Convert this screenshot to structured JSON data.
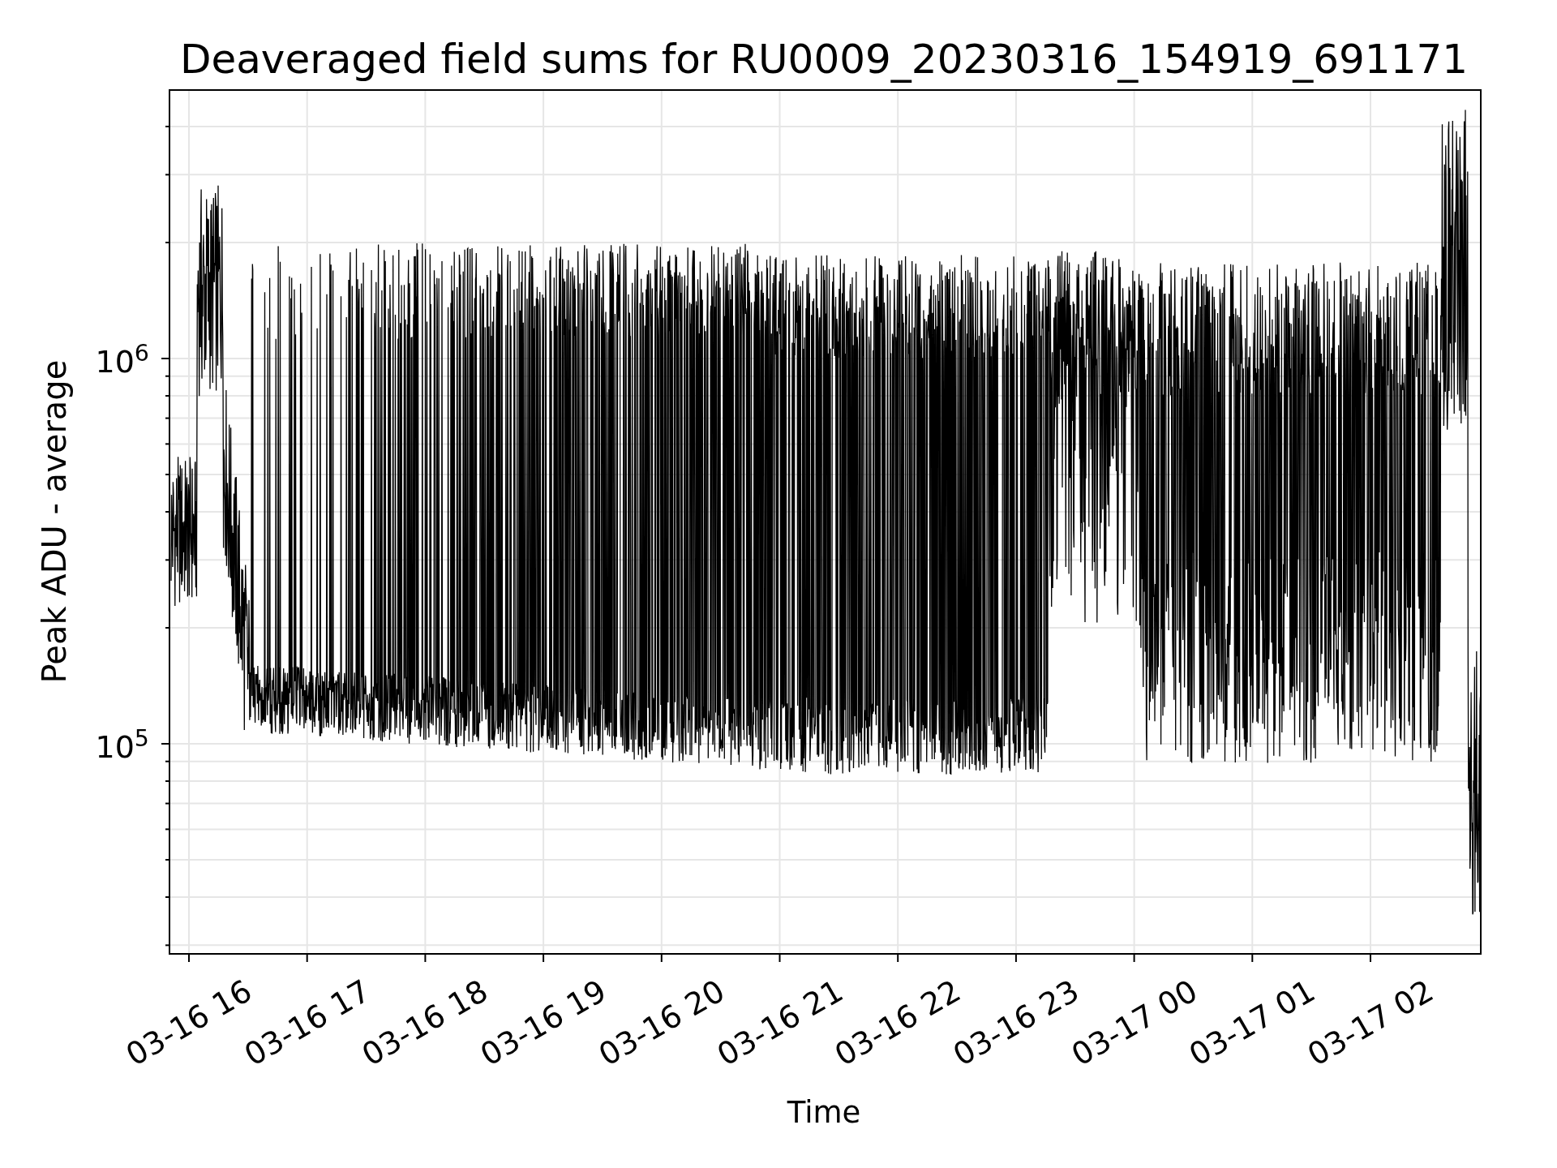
{
  "chart": {
    "title": "Deaveraged field sums for RU0009_20230316_154919_691171",
    "xlabel": "Time",
    "ylabel": "Peak ADU - average",
    "xtick_labels": [
      "03-16 16",
      "03-16 17",
      "03-16 18",
      "03-16 19",
      "03-16 20",
      "03-16 21",
      "03-16 22",
      "03-16 23",
      "03-17 00",
      "03-17 01",
      "03-17 02"
    ],
    "ytick_labels": [
      "10$^{6}$",
      "10$^{5}$"
    ]
  }
}
